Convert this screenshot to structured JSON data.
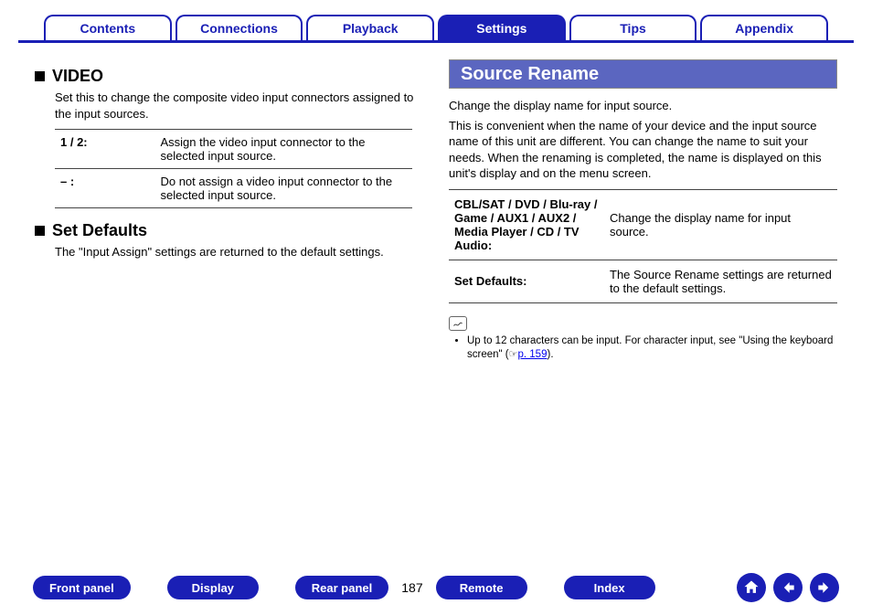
{
  "tabs": {
    "items": [
      {
        "label": "Contents"
      },
      {
        "label": "Connections"
      },
      {
        "label": "Playback"
      },
      {
        "label": "Settings"
      },
      {
        "label": "Tips"
      },
      {
        "label": "Appendix"
      }
    ],
    "active_index": 3
  },
  "left": {
    "video": {
      "heading": "VIDEO",
      "intro": "Set this to change the composite video input connectors assigned to the input sources.",
      "rows": [
        {
          "k": "1 / 2:",
          "v": "Assign the video input connector to the selected input source."
        },
        {
          "k": "– :",
          "v": "Do not assign a video input connector to the selected input source."
        }
      ]
    },
    "set_defaults": {
      "heading": "Set Defaults",
      "text": "The \"Input Assign\" settings are returned to the default settings."
    }
  },
  "right": {
    "title": "Source Rename",
    "para1": "Change the display name for input source.",
    "para2": "This is convenient when the name of your device and the input source name of this unit are different. You can change the name to suit your needs. When the renaming is completed, the name is displayed on this unit's display and on the menu screen.",
    "rows": [
      {
        "k": "CBL/SAT / DVD / Blu-ray / Game / AUX1 / AUX2 / Media Player / CD / TV Audio:",
        "v": "Change the display name for input source."
      },
      {
        "k": "Set Defaults:",
        "v": "The Source Rename settings are returned to the default settings."
      }
    ],
    "note": {
      "text_before": "Up to 12 characters can be input. For character input, see \"Using the keyboard screen\" (",
      "ref": " p. 159",
      "text_after": ")."
    }
  },
  "bottom": {
    "buttons": {
      "front_panel": "Front panel",
      "display": "Display",
      "rear_panel": "Rear panel",
      "remote": "Remote",
      "index": "Index"
    },
    "page_number": "187"
  }
}
